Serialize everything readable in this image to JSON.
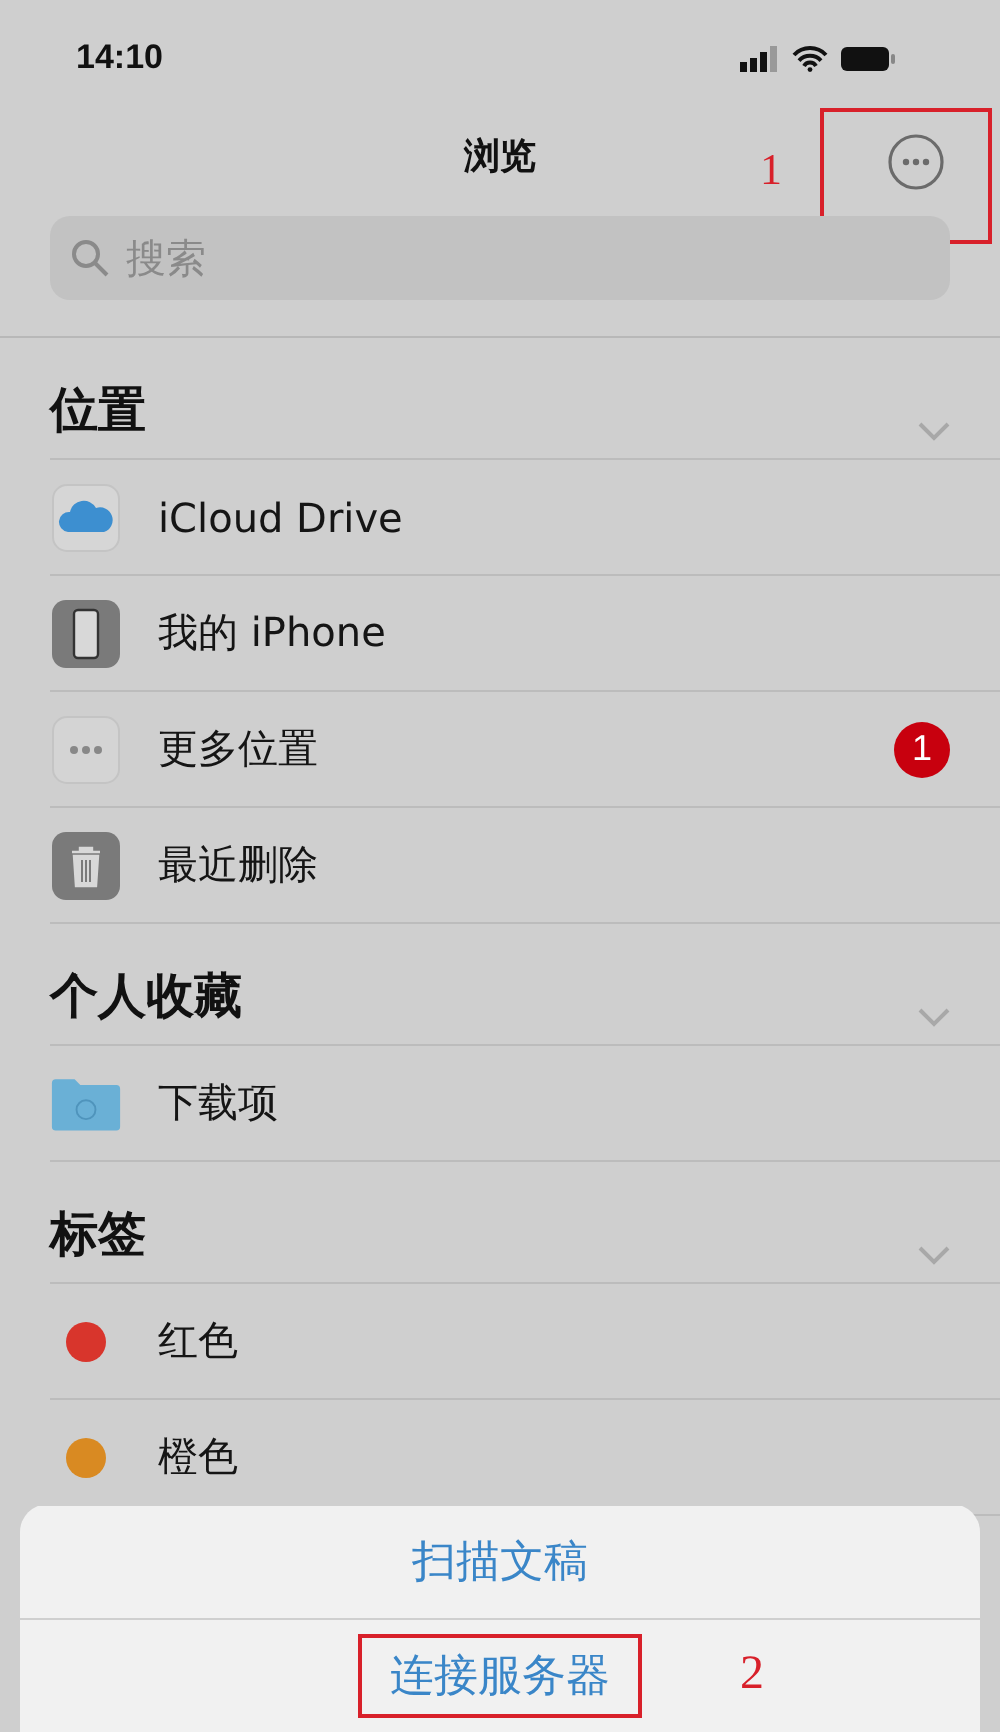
{
  "status_bar": {
    "time": "14:10"
  },
  "nav": {
    "title": "浏览",
    "more_annotation": "1"
  },
  "search": {
    "placeholder": "搜索"
  },
  "sections": [
    {
      "title": "位置",
      "items": [
        {
          "kind": "icloud",
          "label": "iCloud Drive"
        },
        {
          "kind": "phone",
          "label": "我的 iPhone"
        },
        {
          "kind": "more",
          "label": "更多位置",
          "badge": "1"
        },
        {
          "kind": "trash",
          "label": "最近删除"
        }
      ]
    },
    {
      "title": "个人收藏",
      "items": [
        {
          "kind": "folder",
          "label": "下载项"
        }
      ]
    },
    {
      "title": "标签",
      "items": [
        {
          "kind": "tag",
          "label": "红色",
          "color": "#d8352c"
        },
        {
          "kind": "tag",
          "label": "橙色",
          "color": "#d98a22"
        }
      ]
    }
  ],
  "action_sheet": {
    "actions": [
      {
        "label": "扫描文稿"
      },
      {
        "label": "连接服务器",
        "annotation": "2"
      }
    ]
  }
}
